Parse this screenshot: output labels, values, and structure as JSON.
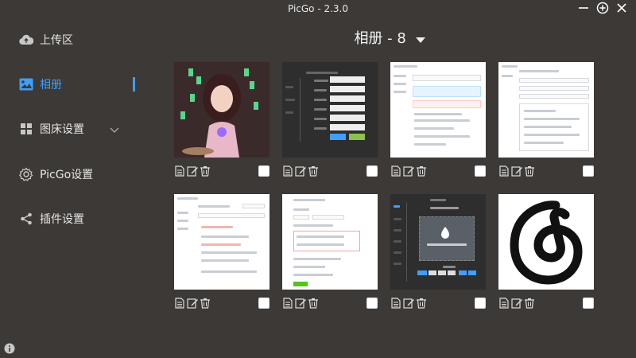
{
  "window": {
    "title": "PicGo - 2.3.0"
  },
  "sidebar": {
    "items": [
      {
        "label": "上传区",
        "icon": "cloud-upload-icon"
      },
      {
        "label": "相册",
        "icon": "image-icon",
        "active": true
      },
      {
        "label": "图床设置",
        "icon": "grid-icon"
      },
      {
        "label": "PicGo设置",
        "icon": "gear-icon"
      },
      {
        "label": "插件设置",
        "icon": "share-icon"
      }
    ]
  },
  "album": {
    "title": "相册 - 8",
    "items": [
      {
        "type": "photo"
      },
      {
        "type": "screenshot-dark"
      },
      {
        "type": "screenshot-light"
      },
      {
        "type": "screenshot-light"
      },
      {
        "type": "screenshot-light"
      },
      {
        "type": "screenshot-light"
      },
      {
        "type": "screenshot-dark"
      },
      {
        "type": "logo"
      }
    ]
  },
  "colors": {
    "accent": "#409eff",
    "background": "#3c3936"
  }
}
